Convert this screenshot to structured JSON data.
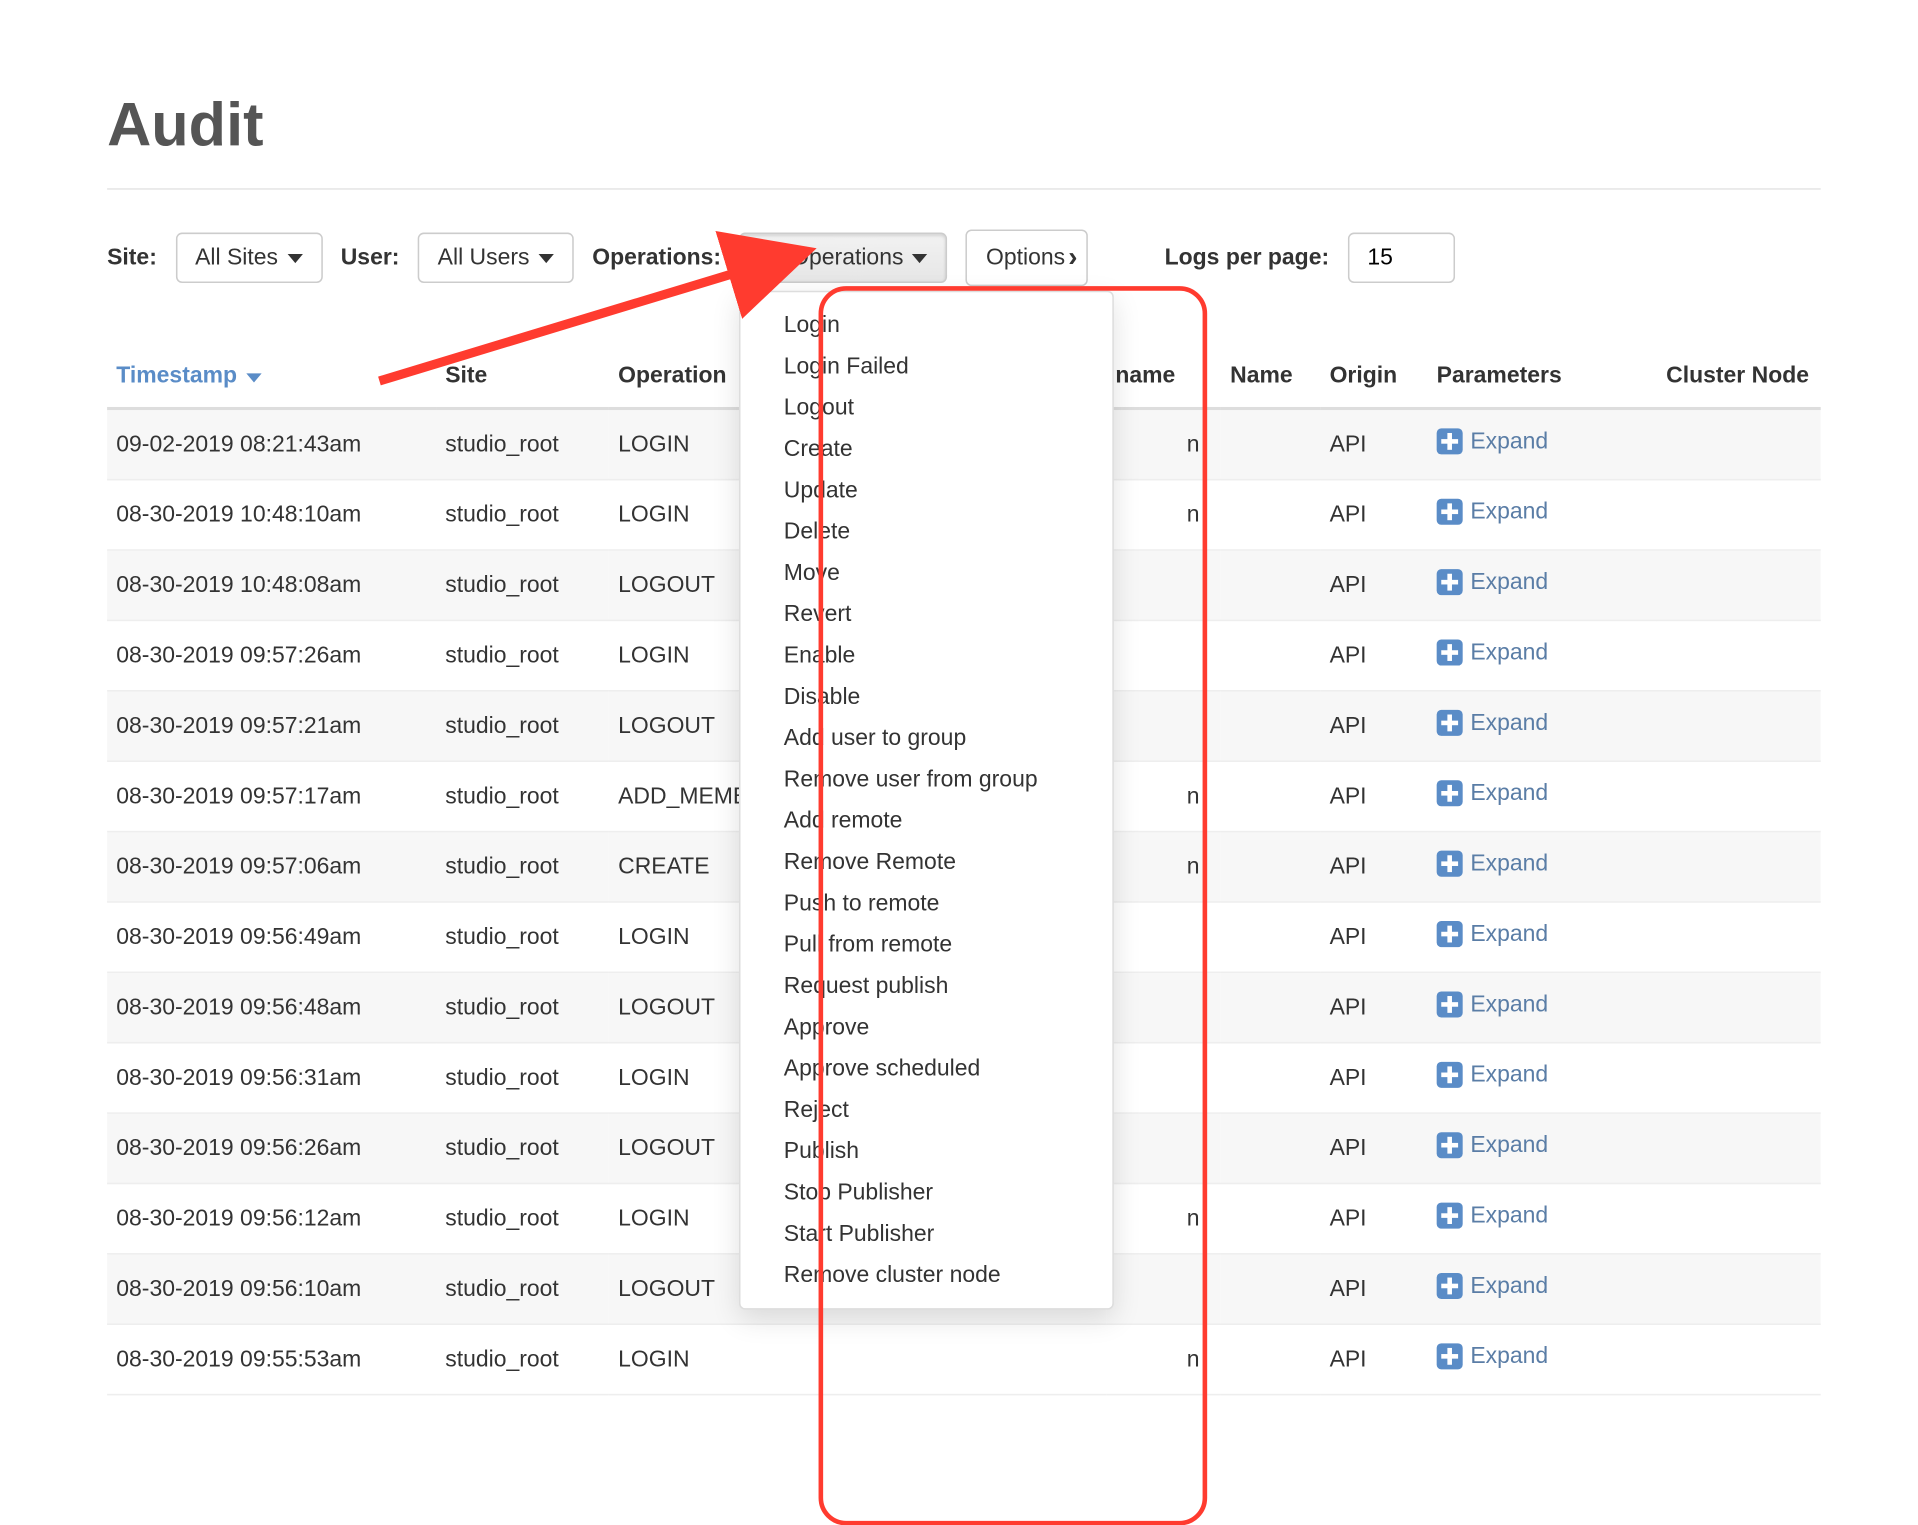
{
  "page_title": "Audit",
  "filters": {
    "site_label": "Site:",
    "site_value": "All Sites",
    "user_label": "User:",
    "user_value": "All Users",
    "operations_label": "Operations:",
    "operations_value": "All Operations",
    "options_label": "Options",
    "logs_per_page_label": "Logs per page:",
    "logs_per_page_value": "15"
  },
  "operations_menu": [
    "Login",
    "Login Failed",
    "Logout",
    "Create",
    "Update",
    "Delete",
    "Move",
    "Revert",
    "Enable",
    "Disable",
    "Add user to group",
    "Remove user from group",
    "Add remote",
    "Remove Remote",
    "Push to remote",
    "Pull from remote",
    "Request publish",
    "Approve",
    "Approve scheduled",
    "Reject",
    "Publish",
    "Stop Publisher",
    "Start Publisher",
    "Remove cluster node"
  ],
  "columns": {
    "timestamp": "Timestamp",
    "site": "Site",
    "operation": "Operation",
    "username": "name",
    "name": "Name",
    "origin": "Origin",
    "parameters": "Parameters",
    "cluster_node": "Cluster Node"
  },
  "expand_label": "Expand",
  "rows": [
    {
      "timestamp": "09-02-2019 08:21:43am",
      "site": "studio_root",
      "operation": "LOGIN",
      "username": "n",
      "origin": "API"
    },
    {
      "timestamp": "08-30-2019 10:48:10am",
      "site": "studio_root",
      "operation": "LOGIN",
      "username": "n",
      "origin": "API"
    },
    {
      "timestamp": "08-30-2019 10:48:08am",
      "site": "studio_root",
      "operation": "LOGOUT",
      "username": "",
      "origin": "API"
    },
    {
      "timestamp": "08-30-2019 09:57:26am",
      "site": "studio_root",
      "operation": "LOGIN",
      "username": "",
      "origin": "API"
    },
    {
      "timestamp": "08-30-2019 09:57:21am",
      "site": "studio_root",
      "operation": "LOGOUT",
      "username": "",
      "origin": "API"
    },
    {
      "timestamp": "08-30-2019 09:57:17am",
      "site": "studio_root",
      "operation": "ADD_MEMBE",
      "username": "n",
      "origin": "API"
    },
    {
      "timestamp": "08-30-2019 09:57:06am",
      "site": "studio_root",
      "operation": "CREATE",
      "username": "n",
      "origin": "API"
    },
    {
      "timestamp": "08-30-2019 09:56:49am",
      "site": "studio_root",
      "operation": "LOGIN",
      "username": "",
      "origin": "API"
    },
    {
      "timestamp": "08-30-2019 09:56:48am",
      "site": "studio_root",
      "operation": "LOGOUT",
      "username": "",
      "origin": "API"
    },
    {
      "timestamp": "08-30-2019 09:56:31am",
      "site": "studio_root",
      "operation": "LOGIN",
      "username": "",
      "origin": "API"
    },
    {
      "timestamp": "08-30-2019 09:56:26am",
      "site": "studio_root",
      "operation": "LOGOUT",
      "username": "",
      "origin": "API"
    },
    {
      "timestamp": "08-30-2019 09:56:12am",
      "site": "studio_root",
      "operation": "LOGIN",
      "username": "n",
      "origin": "API"
    },
    {
      "timestamp": "08-30-2019 09:56:10am",
      "site": "studio_root",
      "operation": "LOGOUT",
      "username": "",
      "origin": "API"
    },
    {
      "timestamp": "08-30-2019 09:55:53am",
      "site": "studio_root",
      "operation": "LOGIN",
      "username": "n",
      "origin": "API"
    }
  ]
}
